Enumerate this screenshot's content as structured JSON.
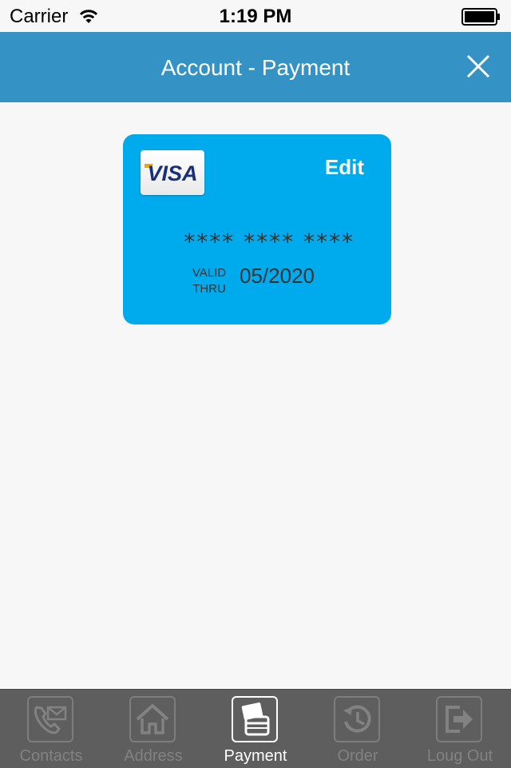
{
  "status_bar": {
    "carrier": "Carrier",
    "time": "1:19 PM"
  },
  "nav": {
    "title": "Account - Payment",
    "close_icon": "close-icon"
  },
  "card": {
    "brand": "VISA",
    "edit_label": "Edit",
    "number_masked": "**** **** ****",
    "valid_line1": "VALID",
    "valid_line2": "THRU",
    "expiry": "05/2020",
    "color": "#00abed"
  },
  "tabs": [
    {
      "label": "Contacts",
      "icon": "phone-mail-icon",
      "active": false
    },
    {
      "label": "Address",
      "icon": "home-icon",
      "active": false
    },
    {
      "label": "Payment",
      "icon": "cards-icon",
      "active": true
    },
    {
      "label": "Order",
      "icon": "history-icon",
      "active": false
    },
    {
      "label": "Loug Out",
      "icon": "logout-icon",
      "active": false
    }
  ],
  "colors": {
    "nav_bar": "#3592c4",
    "tab_bar": "#5e5e5e",
    "background": "#f7f7f7"
  }
}
